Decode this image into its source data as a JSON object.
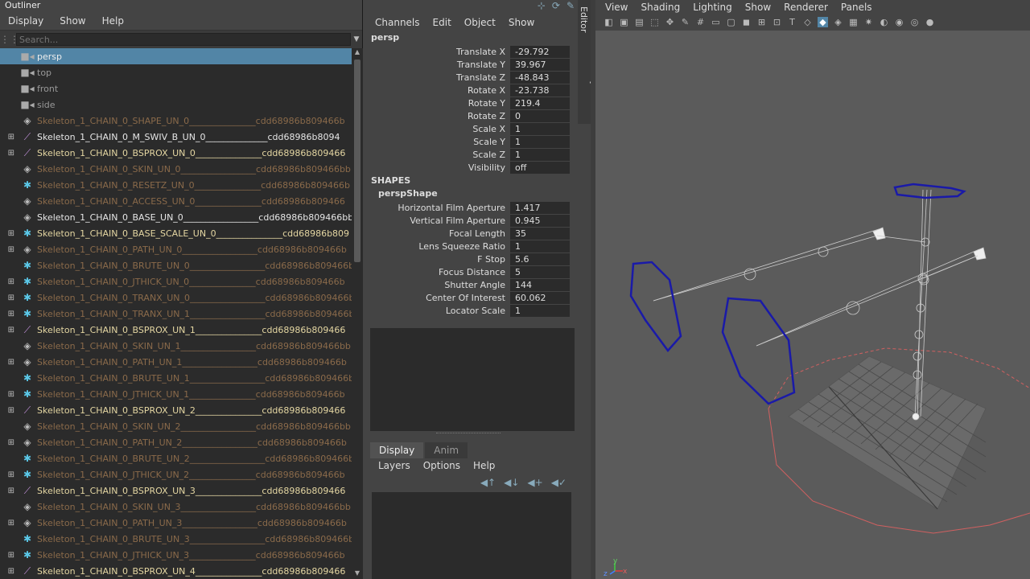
{
  "outliner": {
    "title": "Outliner",
    "menu": [
      "Display",
      "Show",
      "Help"
    ],
    "search_placeholder": "Search...",
    "items": [
      {
        "expand": "",
        "icon": "cam",
        "name": "persp",
        "uuid": "",
        "style": "camsel",
        "selected": true
      },
      {
        "expand": "",
        "icon": "cam",
        "name": "top",
        "uuid": "",
        "style": "cam"
      },
      {
        "expand": "",
        "icon": "cam",
        "name": "front",
        "uuid": "",
        "style": "cam"
      },
      {
        "expand": "",
        "icon": "cam",
        "name": "side",
        "uuid": "",
        "style": "cam"
      },
      {
        "expand": "",
        "icon": "diamond",
        "name": "Skeleton_1_CHAIN_0_SHAPE_UN_0",
        "uuid": "_______________cdd68986b809466b",
        "style": "dim"
      },
      {
        "expand": "+",
        "icon": "joint",
        "name": "Skeleton_1_CHAIN_0_M_SWIV_B_UN_0",
        "uuid": "______________cdd68986b8094",
        "style": "white"
      },
      {
        "expand": "+",
        "icon": "joint",
        "name": "Skeleton_1_CHAIN_0_BSPROX_UN_0",
        "uuid": "_______________cdd68986b809466",
        "style": "yellow"
      },
      {
        "expand": "",
        "icon": "diamond",
        "name": "Skeleton_1_CHAIN_0_SKIN_UN_0",
        "uuid": "_________________cdd68986b809466bb1",
        "style": "dim"
      },
      {
        "expand": "",
        "icon": "star",
        "name": "Skeleton_1_CHAIN_0_RESETZ_UN_0",
        "uuid": "_______________cdd68986b809466b",
        "style": "dim"
      },
      {
        "expand": "",
        "icon": "diamond",
        "name": "Skeleton_1_CHAIN_0_ACCESS_UN_0",
        "uuid": "_______________cdd68986b809466",
        "style": "dim"
      },
      {
        "expand": "",
        "icon": "diamond",
        "name": "Skeleton_1_CHAIN_0_BASE_UN_0",
        "uuid": "_________________cdd68986b809466bb",
        "style": "white"
      },
      {
        "expand": "+",
        "icon": "star",
        "name": "Skeleton_1_CHAIN_0_BASE_SCALE_UN_0",
        "uuid": "_______________cdd68986b809",
        "style": "yellow"
      },
      {
        "expand": "+",
        "icon": "diamond",
        "name": "Skeleton_1_CHAIN_0_PATH_UN_0",
        "uuid": "_________________cdd68986b809466b",
        "style": "dim"
      },
      {
        "expand": "",
        "icon": "star",
        "name": "Skeleton_1_CHAIN_0_BRUTE_UN_0",
        "uuid": "_________________cdd68986b809466b",
        "style": "dim"
      },
      {
        "expand": "+",
        "icon": "star",
        "name": "Skeleton_1_CHAIN_0_JTHICK_UN_0",
        "uuid": "_______________cdd68986b809466b",
        "style": "dim"
      },
      {
        "expand": "+",
        "icon": "star",
        "name": "Skeleton_1_CHAIN_0_TRANX_UN_0",
        "uuid": "_________________cdd68986b809466b",
        "style": "dim"
      },
      {
        "expand": "+",
        "icon": "star",
        "name": "Skeleton_1_CHAIN_0_TRANX_UN_1",
        "uuid": "_________________cdd68986b809466b",
        "style": "dim"
      },
      {
        "expand": "+",
        "icon": "joint",
        "name": "Skeleton_1_CHAIN_0_BSPROX_UN_1",
        "uuid": "_______________cdd68986b809466",
        "style": "yellow"
      },
      {
        "expand": "",
        "icon": "diamond",
        "name": "Skeleton_1_CHAIN_0_SKIN_UN_1",
        "uuid": "_________________cdd68986b809466bb1",
        "style": "dim"
      },
      {
        "expand": "+",
        "icon": "diamond",
        "name": "Skeleton_1_CHAIN_0_PATH_UN_1",
        "uuid": "_________________cdd68986b809466b",
        "style": "dim"
      },
      {
        "expand": "",
        "icon": "star",
        "name": "Skeleton_1_CHAIN_0_BRUTE_UN_1",
        "uuid": "_________________cdd68986b809466b",
        "style": "dim"
      },
      {
        "expand": "+",
        "icon": "star",
        "name": "Skeleton_1_CHAIN_0_JTHICK_UN_1",
        "uuid": "_______________cdd68986b809466b",
        "style": "dim"
      },
      {
        "expand": "+",
        "icon": "joint",
        "name": "Skeleton_1_CHAIN_0_BSPROX_UN_2",
        "uuid": "_______________cdd68986b809466",
        "style": "yellow"
      },
      {
        "expand": "",
        "icon": "diamond",
        "name": "Skeleton_1_CHAIN_0_SKIN_UN_2",
        "uuid": "_________________cdd68986b809466bb1",
        "style": "dim"
      },
      {
        "expand": "+",
        "icon": "diamond",
        "name": "Skeleton_1_CHAIN_0_PATH_UN_2",
        "uuid": "_________________cdd68986b809466b",
        "style": "dim"
      },
      {
        "expand": "",
        "icon": "star",
        "name": "Skeleton_1_CHAIN_0_BRUTE_UN_2",
        "uuid": "_________________cdd68986b809466b",
        "style": "dim"
      },
      {
        "expand": "+",
        "icon": "star",
        "name": "Skeleton_1_CHAIN_0_JTHICK_UN_2",
        "uuid": "_______________cdd68986b809466b",
        "style": "dim"
      },
      {
        "expand": "+",
        "icon": "joint",
        "name": "Skeleton_1_CHAIN_0_BSPROX_UN_3",
        "uuid": "_______________cdd68986b809466",
        "style": "yellow"
      },
      {
        "expand": "",
        "icon": "diamond",
        "name": "Skeleton_1_CHAIN_0_SKIN_UN_3",
        "uuid": "_________________cdd68986b809466bb1",
        "style": "dim"
      },
      {
        "expand": "+",
        "icon": "diamond",
        "name": "Skeleton_1_CHAIN_0_PATH_UN_3",
        "uuid": "_________________cdd68986b809466b",
        "style": "dim"
      },
      {
        "expand": "",
        "icon": "star",
        "name": "Skeleton_1_CHAIN_0_BRUTE_UN_3",
        "uuid": "_________________cdd68986b809466b",
        "style": "dim"
      },
      {
        "expand": "+",
        "icon": "star",
        "name": "Skeleton_1_CHAIN_0_JTHICK_UN_3",
        "uuid": "_______________cdd68986b809466b",
        "style": "dim"
      },
      {
        "expand": "+",
        "icon": "joint",
        "name": "Skeleton_1_CHAIN_0_BSPROX_UN_4",
        "uuid": "_______________cdd68986b809466",
        "style": "yellow"
      }
    ]
  },
  "channelbox": {
    "menu": [
      "Channels",
      "Edit",
      "Object",
      "Show"
    ],
    "object_name": "persp",
    "attributes": [
      {
        "label": "Translate X",
        "value": "-29.792"
      },
      {
        "label": "Translate Y",
        "value": "39.967"
      },
      {
        "label": "Translate Z",
        "value": "-48.843"
      },
      {
        "label": "Rotate X",
        "value": "-23.738"
      },
      {
        "label": "Rotate Y",
        "value": "219.4"
      },
      {
        "label": "Rotate Z",
        "value": "0"
      },
      {
        "label": "Scale X",
        "value": "1"
      },
      {
        "label": "Scale Y",
        "value": "1"
      },
      {
        "label": "Scale Z",
        "value": "1"
      },
      {
        "label": "Visibility",
        "value": "off"
      }
    ],
    "shapes_label": "SHAPES",
    "shape_name": "perspShape",
    "shape_attributes": [
      {
        "label": "Horizontal Film Aperture",
        "value": "1.417"
      },
      {
        "label": "Vertical Film Aperture",
        "value": "0.945"
      },
      {
        "label": "Focal Length",
        "value": "35"
      },
      {
        "label": "Lens Squeeze Ratio",
        "value": "1"
      },
      {
        "label": "F Stop",
        "value": "5.6"
      },
      {
        "label": "Focus Distance",
        "value": "5"
      },
      {
        "label": "Shutter Angle",
        "value": "144"
      },
      {
        "label": "Center Of Interest",
        "value": "60.062"
      },
      {
        "label": "Locator Scale",
        "value": "1"
      }
    ],
    "vertical_tab": "Channel Box / Layer Editor"
  },
  "layer_editor": {
    "tabs": [
      "Display",
      "Anim"
    ],
    "active_tab": "Display",
    "menu": [
      "Layers",
      "Options",
      "Help"
    ]
  },
  "viewport": {
    "menu": [
      "View",
      "Shading",
      "Lighting",
      "Show",
      "Renderer",
      "Panels"
    ],
    "axis_labels": {
      "x": "x",
      "y": "y",
      "z": "z"
    }
  }
}
